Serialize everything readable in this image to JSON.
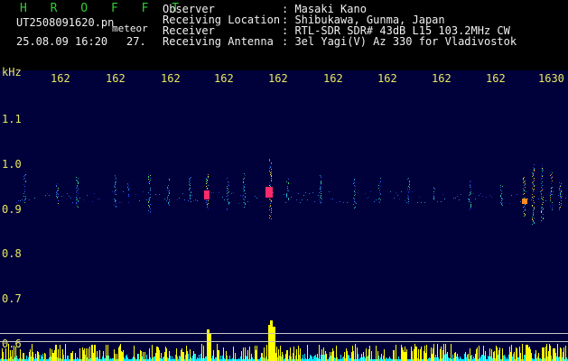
{
  "header": {
    "app_title": "H R O F F T",
    "filename": "UT2508091620.pn",
    "meteor_label": "meteor",
    "datetime": "25.08.09 16:20",
    "count": "27.",
    "info_labels": [
      "Observer",
      "Receiving Location",
      "Receiver",
      "Receiving Antenna"
    ],
    "info_values": [
      ": Masaki Kano",
      ": Shibukawa, Gunma, Japan",
      ": RTL-SDR SDR# 43dB L15 103.2MHz CW",
      ": 3el Yagi(V) Az 330 for Vladivostok"
    ]
  },
  "axis": {
    "unit": "kHz",
    "time_ticks": [
      "162",
      "162",
      "162",
      "162",
      "162",
      "162",
      "162",
      "162",
      "162",
      "1630"
    ],
    "freq_ticks": [
      "1.1",
      "1.0",
      "0.9",
      "0.8",
      "0.7",
      "0.6"
    ]
  },
  "colors": {
    "background": "#00003a",
    "signal_line": "#ffffff",
    "detector": "#ffff00",
    "noise_floor": "#00e8ff",
    "hot": "#ff2a6a"
  }
}
